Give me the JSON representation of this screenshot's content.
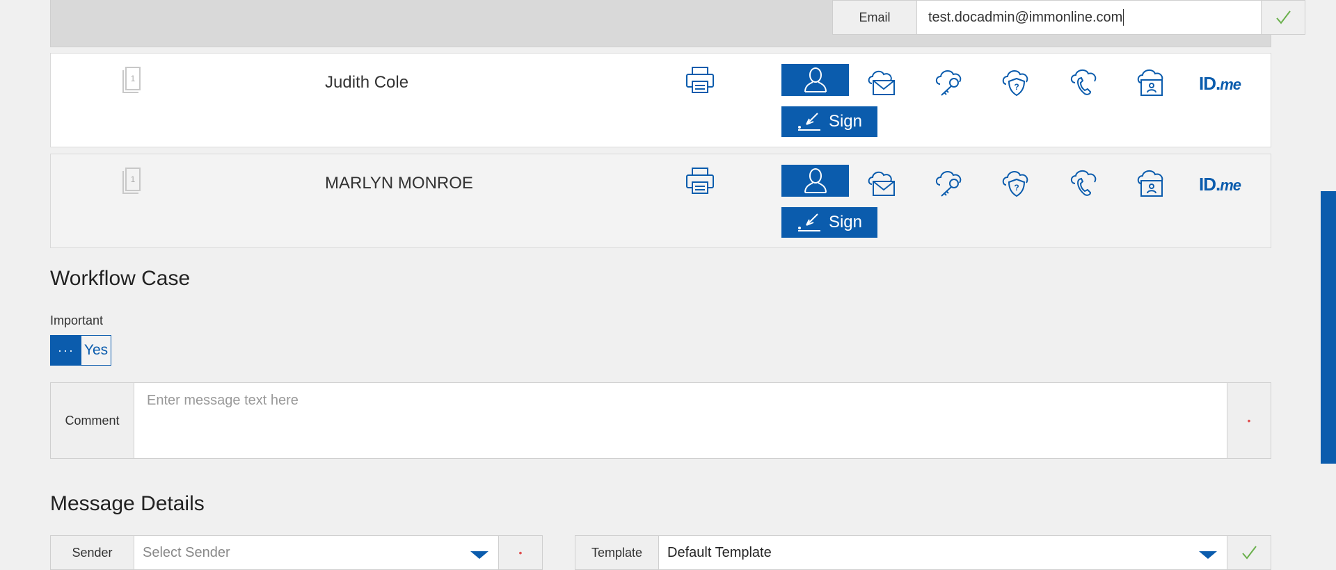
{
  "email": {
    "label": "Email",
    "value": "test.docadmin@immonline.com"
  },
  "signers": [
    {
      "name": "Judith Cole",
      "doc_count": "1",
      "sign_label": "Sign"
    },
    {
      "name": "MARLYN MONROE",
      "doc_count": "1",
      "sign_label": "Sign"
    }
  ],
  "auth_options": [
    "user-icon",
    "cloud-mail-icon",
    "cloud-key-icon",
    "cloud-shield-question-icon",
    "cloud-phone-icon",
    "cloud-id-card-icon",
    "id-me-logo"
  ],
  "idme": {
    "main": "ID.",
    "suffix": "me"
  },
  "workflow": {
    "title": "Workflow Case",
    "important_label": "Important",
    "toggle_knob": "···",
    "toggle_value": "Yes",
    "comment_label": "Comment",
    "comment_placeholder": "Enter message text here",
    "required_marker": "•"
  },
  "message_details": {
    "title": "Message Details",
    "sender_label": "Sender",
    "sender_placeholder": "Select Sender",
    "template_label": "Template",
    "template_value": "Default Template"
  },
  "colors": {
    "accent": "#0b5cad",
    "background": "#f0f0f0",
    "valid": "#6ab04c",
    "required": "#e05050"
  }
}
